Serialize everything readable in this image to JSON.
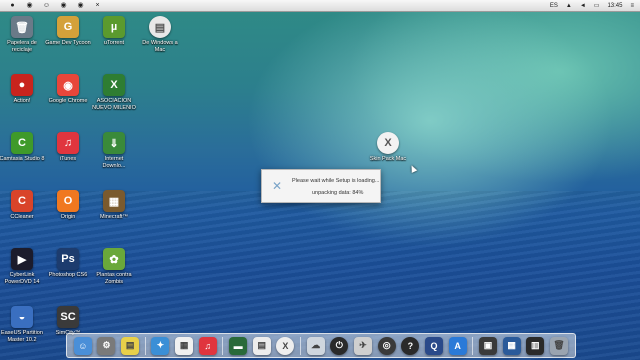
{
  "menubar": {
    "right_lang": "ES",
    "time": "13:45"
  },
  "desktop_icons": [
    {
      "label": "Papelera de\nreciclaje",
      "icon": "trash-icon",
      "color": "#6a7a88",
      "glyph": "🗑"
    },
    {
      "label": "Game Dev Tycoon",
      "icon": "game-dev-tycoon-icon",
      "color": "#d4a13a",
      "glyph": "G"
    },
    {
      "label": "uTorrent",
      "icon": "utorrent-icon",
      "color": "#5b9a2e",
      "glyph": "µ"
    },
    {
      "label": "De Windows a\nMac",
      "icon": "document-icon",
      "color": "#e8e8e8",
      "glyph": "▤"
    },
    {
      "label": "Action!",
      "icon": "action-recorder-icon",
      "color": "#c8241e",
      "glyph": "●"
    },
    {
      "label": "Google Chrome",
      "icon": "chrome-icon",
      "color": "#e8463a",
      "glyph": "◉"
    },
    {
      "label": "ASOCIACION\nNUEVO MILENIO",
      "icon": "excel-file-icon",
      "color": "#2e7d32",
      "glyph": "X"
    },
    {
      "label": "Camtasia Studio 8",
      "icon": "camtasia-icon",
      "color": "#3f9a2a",
      "glyph": "C"
    },
    {
      "label": "iTunes",
      "icon": "itunes-icon",
      "color": "#e0353e",
      "glyph": "♫"
    },
    {
      "label": "Internet\nDownlo...",
      "icon": "internet-download-manager-icon",
      "color": "#3a8a3a",
      "glyph": "⇓"
    },
    {
      "label": "CCleaner",
      "icon": "ccleaner-icon",
      "color": "#d9442a",
      "glyph": "C"
    },
    {
      "label": "Origin",
      "icon": "origin-icon",
      "color": "#f07820",
      "glyph": "O"
    },
    {
      "label": "Minecraft™",
      "icon": "minecraft-icon",
      "color": "#7a5a2e",
      "glyph": "▦"
    },
    {
      "label": "CyberLink\nPowerDVD 14",
      "icon": "powerdvd-icon",
      "color": "#1c1c2c",
      "glyph": "▶"
    },
    {
      "label": "Photoshop CS6",
      "icon": "photoshop-icon",
      "color": "#1d3c6e",
      "glyph": "Ps"
    },
    {
      "label": "Plantas contra\nZombis",
      "icon": "plants-vs-zombies-icon",
      "color": "#6aa83a",
      "glyph": "✿"
    },
    {
      "label": "EaseUS Partition\nMaster 10.2",
      "icon": "easeus-partition-icon",
      "color": "#3a6fc0",
      "glyph": "◒"
    },
    {
      "label": "SimCity™",
      "icon": "simcity-icon",
      "color": "#3a3a3a",
      "glyph": "SC"
    },
    {
      "label": "Skin Pack Mac",
      "icon": "skin-pack-mac-icon",
      "color": "#f2f2f2",
      "glyph": "X"
    }
  ],
  "dialog": {
    "line1": "Please wait while Setup is loading...",
    "line2": "unpacking data: 84%"
  },
  "dock": [
    {
      "icon": "finder-icon",
      "color": "#4a8fd8",
      "glyph": "☺"
    },
    {
      "icon": "system-preferences-icon",
      "color": "#7a7a7a",
      "glyph": "⚙"
    },
    {
      "icon": "sticky-notes-icon",
      "color": "#e8d04a",
      "glyph": "▤"
    },
    {
      "icon": "separator",
      "color": "",
      "glyph": ""
    },
    {
      "icon": "safari-icon",
      "color": "#3b8fd6",
      "glyph": "✦"
    },
    {
      "icon": "calendar-icon",
      "color": "#f0f0f0",
      "glyph": "▦"
    },
    {
      "icon": "itunes-icon",
      "color": "#e0353e",
      "glyph": "♫"
    },
    {
      "icon": "separator",
      "color": "",
      "glyph": ""
    },
    {
      "icon": "terminal-icon",
      "color": "#2a6a3a",
      "glyph": "▬"
    },
    {
      "icon": "document-icon",
      "color": "#ececec",
      "glyph": "▤"
    },
    {
      "icon": "skin-pack-mac-icon",
      "color": "#eeeeee",
      "glyph": "X"
    },
    {
      "icon": "separator",
      "color": "",
      "glyph": ""
    },
    {
      "icon": "icloud-icon",
      "color": "#cfd6de",
      "glyph": "☁"
    },
    {
      "icon": "power-icon",
      "color": "#2a2a2a",
      "glyph": "⏻"
    },
    {
      "icon": "bird-icon",
      "color": "#cfcfcf",
      "glyph": "✈"
    },
    {
      "icon": "dashboard-icon",
      "color": "#3a3a3a",
      "glyph": "◎"
    },
    {
      "icon": "help-icon",
      "color": "#2a2a2a",
      "glyph": "?"
    },
    {
      "icon": "quicktime-icon",
      "color": "#2a4a8a",
      "glyph": "Q"
    },
    {
      "icon": "app-store-icon",
      "color": "#2a7ad8",
      "glyph": "A"
    },
    {
      "icon": "separator",
      "color": "",
      "glyph": ""
    },
    {
      "icon": "window-icon",
      "color": "#3a3a3a",
      "glyph": "▣"
    },
    {
      "icon": "grid-icon",
      "color": "#2a5a9a",
      "glyph": "▦"
    },
    {
      "icon": "expose-icon",
      "color": "#2a2a2a",
      "glyph": "▥"
    },
    {
      "icon": "trash-icon",
      "color": "#9aa4b0",
      "glyph": "🗑"
    }
  ]
}
